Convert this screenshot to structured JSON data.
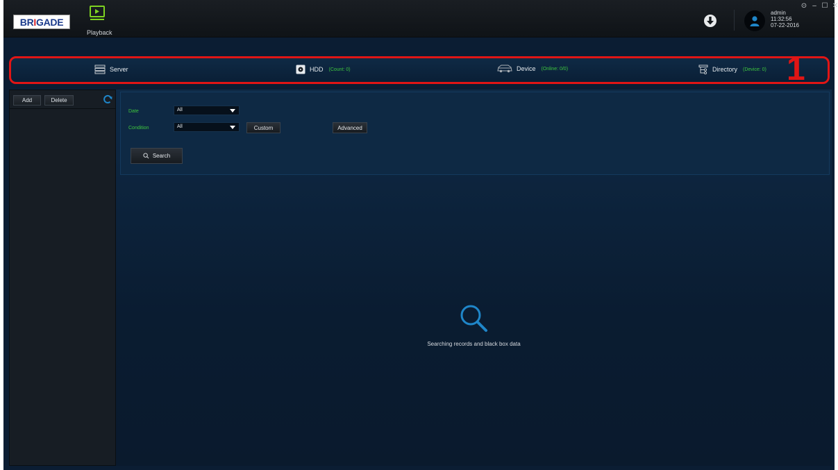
{
  "header": {
    "logo_text_1": "BR",
    "logo_text_2": "I",
    "logo_text_3": "GADE",
    "playback_label": "Playback",
    "user": {
      "name": "admin",
      "time": "11:32:56",
      "date": "07-22-2016"
    },
    "window_controls": [
      "⊙",
      "–",
      "☐",
      "✕"
    ]
  },
  "stats": {
    "server": {
      "label": "Server",
      "sub": ""
    },
    "hdd": {
      "label": "HDD",
      "sub": "(Count: 0)"
    },
    "device": {
      "label": "Device",
      "sub": "(Online: 0/0)"
    },
    "directory": {
      "label": "Directory",
      "sub": "(Device: 0)"
    },
    "annotation": "1"
  },
  "left_panel": {
    "add_label": "Add",
    "delete_label": "Delete"
  },
  "filters": {
    "date_label": "Date",
    "date_value": "All",
    "condition_label": "Condition",
    "condition_value": "All",
    "custom_label": "Custom",
    "advanced_label": "Advanced",
    "search_label": "Search"
  },
  "empty_state": {
    "text": "Searching records and black box data"
  },
  "colors": {
    "accent_green": "#3ec53e",
    "annotation_red": "#e11515",
    "background": "#0b1d33",
    "icon_blue": "#1f86c9"
  }
}
